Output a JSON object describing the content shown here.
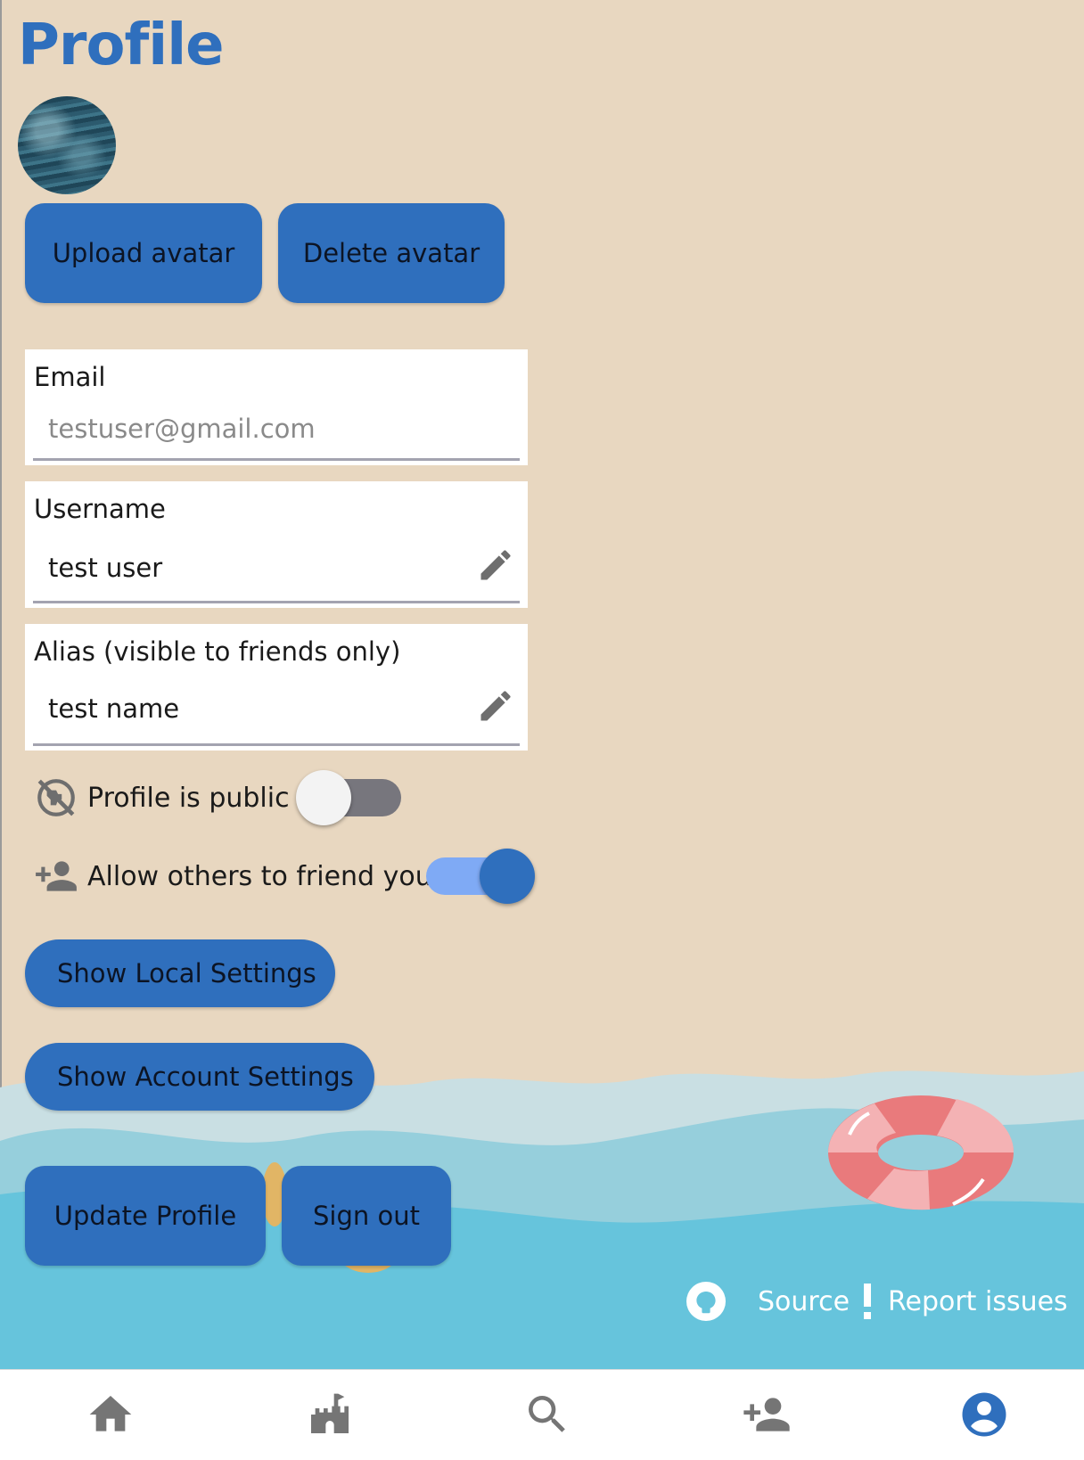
{
  "page": {
    "title": "Profile"
  },
  "avatar_actions": {
    "upload_label": "Upload avatar",
    "delete_label": "Delete avatar"
  },
  "fields": {
    "email": {
      "label": "Email",
      "value": "testuser@gmail.com"
    },
    "username": {
      "label": "Username",
      "value": "test user"
    },
    "alias": {
      "label": "Alias (visible to friends only)",
      "value": "test name"
    }
  },
  "toggles": {
    "public_profile": {
      "label": "Profile is public",
      "on": false,
      "icon": "public-off-icon"
    },
    "allow_friends": {
      "label": "Allow others to friend you",
      "on": true,
      "icon": "person-add-icon"
    }
  },
  "settings_buttons": {
    "local": "Show Local Settings",
    "account": "Show Account Settings"
  },
  "actions": {
    "update": "Update Profile",
    "sign_out": "Sign out"
  },
  "footer": {
    "source": {
      "label": "Source",
      "icon": "github-icon"
    },
    "report": {
      "label": "Report issues",
      "icon": "exclamation-icon"
    }
  },
  "bottom_nav": {
    "items": [
      {
        "name": "home",
        "icon": "home-icon",
        "active": false
      },
      {
        "name": "castle",
        "icon": "castle-icon",
        "active": false
      },
      {
        "name": "search",
        "icon": "search-icon",
        "active": false
      },
      {
        "name": "add-friend",
        "icon": "person-add-icon",
        "active": false
      },
      {
        "name": "profile",
        "icon": "account-circle-icon",
        "active": true
      }
    ]
  },
  "colors": {
    "accent": "#2f6fbd",
    "background": "#e8d7c0",
    "toggle_on_track": "#7faaf5",
    "toggle_off_track": "#77767d",
    "water_light": "#c9dfe3",
    "water_mid": "#96cfdc",
    "water_deep": "#66c4dc"
  }
}
